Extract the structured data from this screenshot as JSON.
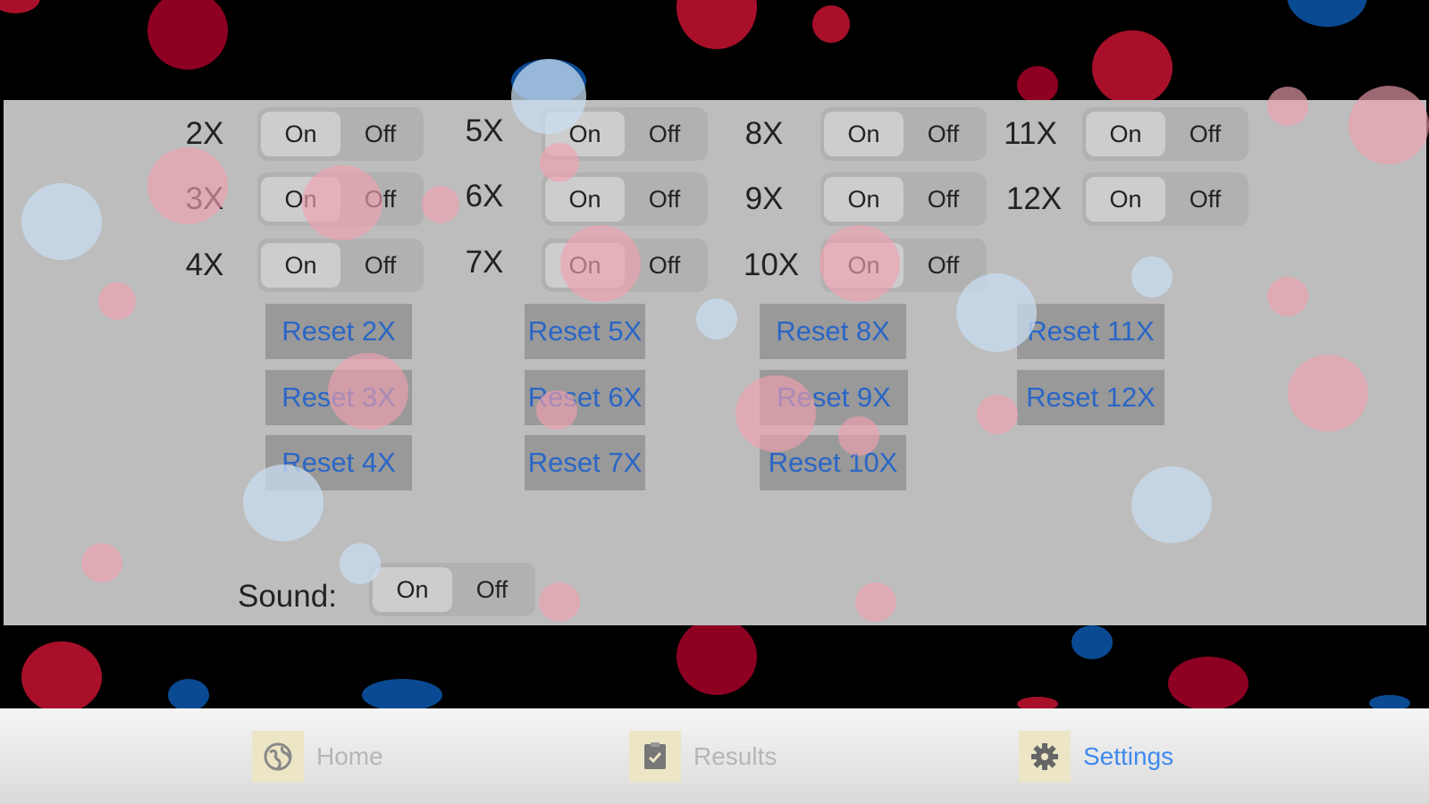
{
  "multipliers": [
    {
      "label": "2X",
      "on_label": "On",
      "off_label": "Off",
      "selected": "on"
    },
    {
      "label": "3X",
      "on_label": "On",
      "off_label": "Off",
      "selected": "on"
    },
    {
      "label": "4X",
      "on_label": "On",
      "off_label": "Off",
      "selected": "on"
    },
    {
      "label": "5X",
      "on_label": "On",
      "off_label": "Off",
      "selected": "on"
    },
    {
      "label": "6X",
      "on_label": "On",
      "off_label": "Off",
      "selected": "on"
    },
    {
      "label": "7X",
      "on_label": "On",
      "off_label": "Off",
      "selected": "on"
    },
    {
      "label": "8X",
      "on_label": "On",
      "off_label": "Off",
      "selected": "on"
    },
    {
      "label": "9X",
      "on_label": "On",
      "off_label": "Off",
      "selected": "on"
    },
    {
      "label": "10X",
      "on_label": "On",
      "off_label": "Off",
      "selected": "on"
    },
    {
      "label": "11X",
      "on_label": "On",
      "off_label": "Off",
      "selected": "on"
    },
    {
      "label": "12X",
      "on_label": "On",
      "off_label": "Off",
      "selected": "on"
    }
  ],
  "reset_buttons": [
    "Reset 2X",
    "Reset 3X",
    "Reset 4X",
    "Reset 5X",
    "Reset 6X",
    "Reset 7X",
    "Reset 8X",
    "Reset 9X",
    "Reset 10X",
    "Reset 11X",
    "Reset 12X"
  ],
  "sound": {
    "label": "Sound:",
    "on_label": "On",
    "off_label": "Off",
    "selected": "on"
  },
  "tabbar": {
    "items": [
      {
        "label": "Home",
        "icon": "globe-icon",
        "active": false
      },
      {
        "label": "Results",
        "icon": "checklist-icon",
        "active": false
      },
      {
        "label": "Settings",
        "icon": "gear-icon",
        "active": true
      }
    ]
  },
  "colors": {
    "accent": "#3f89ee",
    "link": "#2a66c6",
    "panel": "#bdbdbd",
    "bubble_red": "#a8102a",
    "bubble_blue": "#0a4a93"
  }
}
